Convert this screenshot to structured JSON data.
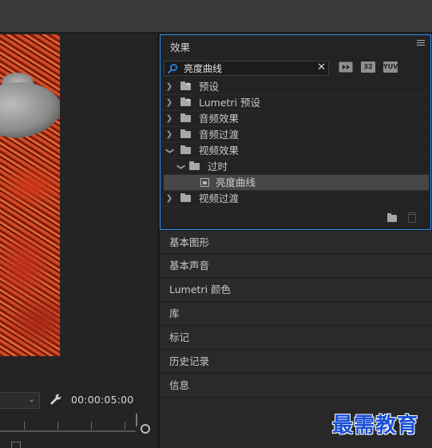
{
  "effects_panel": {
    "title": "效果",
    "search": {
      "value": "亮度曲线",
      "placeholder": ""
    },
    "toolbar_badges": [
      "32",
      "YUV"
    ],
    "tree": [
      {
        "label": "预设",
        "type": "preset-folder",
        "expanded": false,
        "level": 0
      },
      {
        "label": "Lumetri 预设",
        "type": "preset-folder",
        "expanded": false,
        "level": 0
      },
      {
        "label": "音频效果",
        "type": "folder",
        "expanded": false,
        "level": 0
      },
      {
        "label": "音频过渡",
        "type": "folder",
        "expanded": false,
        "level": 0
      },
      {
        "label": "视频效果",
        "type": "folder",
        "expanded": true,
        "level": 0
      },
      {
        "label": "过时",
        "type": "folder",
        "expanded": true,
        "level": 1
      },
      {
        "label": "亮度曲线",
        "type": "effect",
        "selected": true,
        "level": 2
      },
      {
        "label": "视频过渡",
        "type": "folder",
        "expanded": false,
        "level": 0
      }
    ]
  },
  "collapsed_panels": [
    "基本图形",
    "基本声音",
    "Lumetri 颜色",
    "库",
    "标记",
    "历史记录",
    "信息"
  ],
  "monitor": {
    "timecode": "00:00:05:00"
  },
  "watermark": "最需教育",
  "colors": {
    "accent_border": "#2d8ceb",
    "watermark": "#1a4fd6"
  }
}
